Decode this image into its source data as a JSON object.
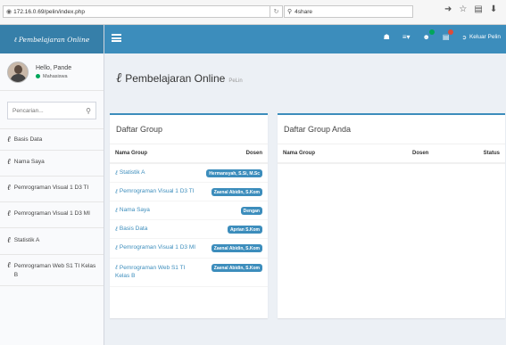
{
  "browser": {
    "url": "172.16.0.69/pelin/index.php",
    "search_value": "4share"
  },
  "sidebar": {
    "brand": "Pembelajaran Online",
    "user_name": "Hello, Pande",
    "user_status": "Mahasiswa",
    "search_placeholder": "Pencarian...",
    "items": [
      {
        "label": "Basis Data"
      },
      {
        "label": "Nama Saya"
      },
      {
        "label": "Pemrograman Visual 1 D3 TI"
      },
      {
        "label": "Pemrograman Visual 1 D3 MI"
      },
      {
        "label": "Statistik A"
      },
      {
        "label": "Pemrograman Web S1 TI Kelas B"
      }
    ]
  },
  "topnav": {
    "logout_label": "Keluar Pelin"
  },
  "header": {
    "title": "Pembelajaran Online",
    "subtitle": "PeLin"
  },
  "left_box": {
    "title": "Daftar Group",
    "col_name": "Nama Group",
    "col_dosen": "Dosen",
    "rows": [
      {
        "name": "Statistik A",
        "dosen": "Hermansyah, S.Si, M.Sc"
      },
      {
        "name": "Pemrograman Visual 1 D3 TI",
        "dosen": "Zaenal Abidin, S.Kom"
      },
      {
        "name": "Nama Saya",
        "dosen": "Dengan"
      },
      {
        "name": "Basis Data",
        "dosen": "Aprian S.Kom"
      },
      {
        "name": "Pemrograman Visual 1 D3 MI",
        "dosen": "Zaenal Abidin, S.Kom"
      },
      {
        "name_line1": "Pemrograman Web S1 TI",
        "name_line2": "Kelas B",
        "dosen": "Zaenal Abidin, S.Kom"
      }
    ]
  },
  "right_box": {
    "title": "Daftar Group Anda",
    "col_name": "Nama Group",
    "col_dosen": "Dosen",
    "col_status": "Status"
  },
  "colors": {
    "primary": "#3c8dbc",
    "brand_bar": "#367fa9",
    "online": "#00a65a"
  }
}
